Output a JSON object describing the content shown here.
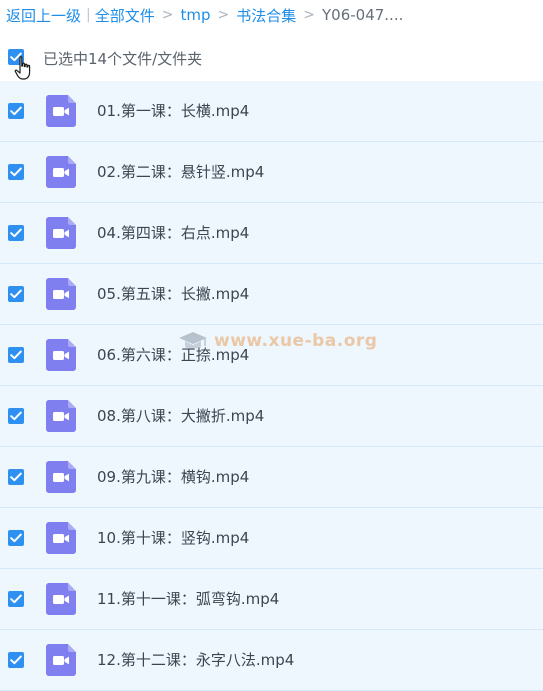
{
  "breadcrumb": {
    "back": "返回上一级",
    "all_files": "全部文件",
    "tmp": "tmp",
    "folder": "书法合集",
    "current": "Y06-047....",
    "bar": "|",
    "sep": ">"
  },
  "select_all": {
    "label": "已选中14个文件/文件夹",
    "checked": true
  },
  "files": [
    {
      "name": "01.第一课：长横.mp4",
      "checked": true
    },
    {
      "name": "02.第二课：悬针竖.mp4",
      "checked": true
    },
    {
      "name": "04.第四课：右点.mp4",
      "checked": true
    },
    {
      "name": "05.第五课：长撇.mp4",
      "checked": true
    },
    {
      "name": "06.第六课：正捺.mp4",
      "checked": true
    },
    {
      "name": "08.第八课：大撇折.mp4",
      "checked": true
    },
    {
      "name": "09.第九课：横钩.mp4",
      "checked": true
    },
    {
      "name": "10.第十课：竖钩.mp4",
      "checked": true
    },
    {
      "name": "11.第十一课：弧弯钩.mp4",
      "checked": true
    },
    {
      "name": "12.第十二课：永字八法.mp4",
      "checked": true
    }
  ],
  "watermark": {
    "text": "www.xue-ba.org"
  },
  "colors": {
    "accent": "#2e91f2",
    "link": "#1f8ee8",
    "video_icon": "#7f7ff0",
    "row_bg": "#eef7fe",
    "row_border": "#d6e9f9"
  },
  "icons": {
    "checkbox": "check-icon",
    "file": "video-file-icon",
    "cursor": "hand-cursor-icon"
  }
}
